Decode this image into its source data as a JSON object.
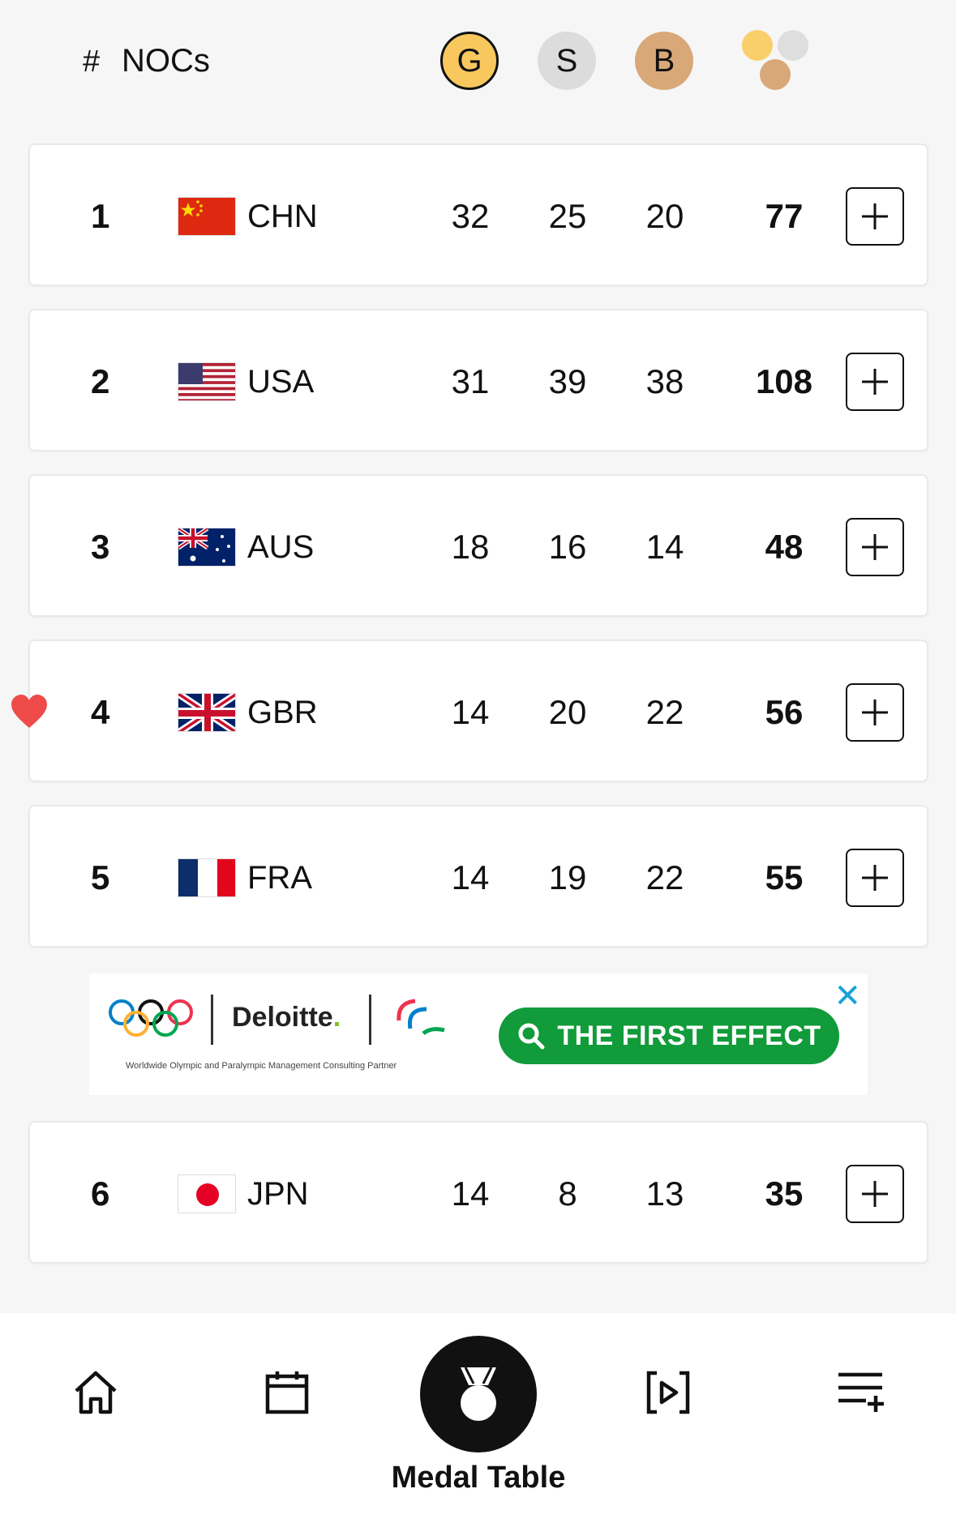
{
  "header": {
    "rank_label": "#",
    "nocs_label": "NOCs",
    "gold_label": "G",
    "silver_label": "S",
    "bronze_label": "B",
    "total_icon": "stacked-medals-icon"
  },
  "rows": [
    {
      "rank": "1",
      "noc": "CHN",
      "gold": "32",
      "silver": "25",
      "bronze": "20",
      "total": "77",
      "flag": "flag-chn-icon",
      "favorite": false
    },
    {
      "rank": "2",
      "noc": "USA",
      "gold": "31",
      "silver": "39",
      "bronze": "38",
      "total": "108",
      "flag": "flag-usa-icon",
      "favorite": false
    },
    {
      "rank": "3",
      "noc": "AUS",
      "gold": "18",
      "silver": "16",
      "bronze": "14",
      "total": "48",
      "flag": "flag-aus-icon",
      "favorite": false
    },
    {
      "rank": "4",
      "noc": "GBR",
      "gold": "14",
      "silver": "20",
      "bronze": "22",
      "total": "56",
      "flag": "flag-gbr-icon",
      "favorite": true
    },
    {
      "rank": "5",
      "noc": "FRA",
      "gold": "14",
      "silver": "19",
      "bronze": "22",
      "total": "55",
      "flag": "flag-fra-icon",
      "favorite": false
    },
    {
      "rank": "6",
      "noc": "JPN",
      "gold": "14",
      "silver": "8",
      "bronze": "13",
      "total": "35",
      "flag": "flag-jpn-icon",
      "favorite": false
    }
  ],
  "ad": {
    "brand": "Deloitte",
    "brand_dot": ".",
    "tagline": "Worldwide Olympic and Paralympic Management Consulting Partner",
    "cta": "THE FIRST EFFECT",
    "close": "✕"
  },
  "nav": {
    "items": [
      {
        "name": "home",
        "icon": "home-icon"
      },
      {
        "name": "schedule",
        "icon": "calendar-icon"
      },
      {
        "name": "medal-table",
        "icon": "medal-icon",
        "label": "Medal Table",
        "active": true
      },
      {
        "name": "videos",
        "icon": "play-icon"
      },
      {
        "name": "more",
        "icon": "menu-add-icon"
      }
    ]
  },
  "colors": {
    "gold": "#f8c85f",
    "silver": "#dcdcdc",
    "bronze": "#d9a878",
    "favorite": "#ef4b4b",
    "ad_cta": "#119b3a"
  }
}
